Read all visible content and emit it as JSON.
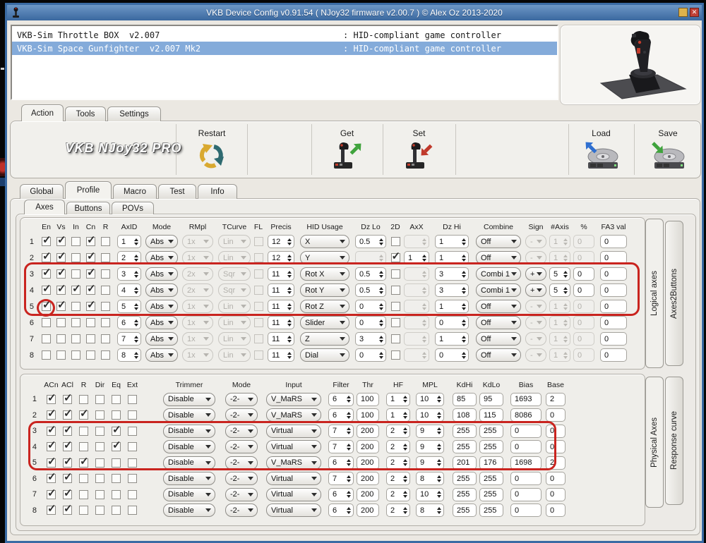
{
  "window": {
    "title": "VKB Device Config v0.91.54 ( NJoy32 firmware v2.00.7 ) © Alex Oz 2013-2020"
  },
  "colors": {
    "titlebar": "#3a689f",
    "selection": "#84abda",
    "annotation": "#c9241f"
  },
  "devices": [
    {
      "name": "VKB-Sim Throttle BOX  v2.007",
      "type": ": HID-compliant game controller"
    },
    {
      "name": "VKB-Sim Space Gunfighter  v2.007 Mk2",
      "type": ": HID-compliant game controller"
    }
  ],
  "main_tabs": [
    "Action",
    "Tools",
    "Settings"
  ],
  "toolbar": {
    "logo": "VKB NJoy32 PRO",
    "restart_label": "Restart",
    "get_label": "Get",
    "set_label": "Set",
    "load_label": "Load",
    "save_label": "Save"
  },
  "profile_tabs": [
    "Global",
    "Profile",
    "Macro",
    "Test",
    "Info"
  ],
  "axes_tabs": [
    "Axes",
    "Buttons",
    "POVs"
  ],
  "side_tabs": {
    "upper": [
      "Logical axes",
      "Axes2Buttons"
    ],
    "lower": [
      "Physical Axes",
      "Response curve"
    ]
  },
  "logical_table": {
    "headers": [
      "En",
      "Vs",
      "In",
      "Cn",
      "R",
      "AxID",
      "Mode",
      "RMpl",
      "TCurve",
      "FL",
      "Precis",
      "HID Usage",
      "Dz Lo",
      "2D",
      "AxX",
      "Dz Hi",
      "Combine",
      "Sign",
      "#Axis",
      "%",
      "FA3 val"
    ],
    "rows": [
      {
        "n": "1",
        "en": true,
        "vs": true,
        "in": false,
        "cn": true,
        "r": false,
        "axid": "1",
        "mode": "Abs",
        "rmpl": "1x",
        "tcurve": "Lin",
        "fl": false,
        "precis": "12",
        "hid": "X",
        "dzlo": "0.5",
        "d2": false,
        "axx": "",
        "dzhi": "1",
        "combine": "Off",
        "sign": "-",
        "naxis": "1",
        "pct": "0",
        "fa3": "0"
      },
      {
        "n": "2",
        "en": true,
        "vs": true,
        "in": false,
        "cn": true,
        "r": false,
        "axid": "2",
        "mode": "Abs",
        "rmpl": "1x",
        "tcurve": "Lin",
        "fl": false,
        "precis": "12",
        "hid": "Y",
        "dzlo": "",
        "d2": true,
        "axx": "1",
        "dzhi": "1",
        "combine": "Off",
        "sign": "-",
        "naxis": "1",
        "pct": "0",
        "fa3": "0"
      },
      {
        "n": "3",
        "en": true,
        "vs": true,
        "in": false,
        "cn": true,
        "r": false,
        "axid": "3",
        "mode": "Abs",
        "rmpl": "2x",
        "tcurve": "Sqr",
        "fl": false,
        "precis": "11",
        "hid": "Rot X",
        "dzlo": "0.5",
        "d2": false,
        "axx": "",
        "dzhi": "3",
        "combine": "Combi 1",
        "sign": "+",
        "naxis": "5",
        "pct": "0",
        "fa3": "0"
      },
      {
        "n": "4",
        "en": true,
        "vs": true,
        "in": true,
        "cn": true,
        "r": false,
        "axid": "4",
        "mode": "Abs",
        "rmpl": "2x",
        "tcurve": "Sqr",
        "fl": false,
        "precis": "11",
        "hid": "Rot Y",
        "dzlo": "0.5",
        "d2": false,
        "axx": "",
        "dzhi": "3",
        "combine": "Combi 1",
        "sign": "+",
        "naxis": "5",
        "pct": "0",
        "fa3": "0"
      },
      {
        "n": "5",
        "en": true,
        "vs": true,
        "in": false,
        "cn": true,
        "r": false,
        "axid": "5",
        "mode": "Abs",
        "rmpl": "1x",
        "tcurve": "Lin",
        "fl": false,
        "precis": "11",
        "hid": "Rot Z",
        "dzlo": "0",
        "d2": false,
        "axx": "",
        "dzhi": "1",
        "combine": "Off",
        "sign": "-",
        "naxis": "1",
        "pct": "0",
        "fa3": "0"
      },
      {
        "n": "6",
        "en": false,
        "vs": false,
        "in": false,
        "cn": false,
        "r": false,
        "axid": "6",
        "mode": "Abs",
        "rmpl": "1x",
        "tcurve": "Lin",
        "fl": false,
        "precis": "11",
        "hid": "Slider",
        "dzlo": "0",
        "d2": false,
        "axx": "",
        "dzhi": "0",
        "combine": "Off",
        "sign": "-",
        "naxis": "1",
        "pct": "0",
        "fa3": "0"
      },
      {
        "n": "7",
        "en": false,
        "vs": false,
        "in": false,
        "cn": false,
        "r": false,
        "axid": "7",
        "mode": "Abs",
        "rmpl": "1x",
        "tcurve": "Lin",
        "fl": false,
        "precis": "11",
        "hid": "Z",
        "dzlo": "3",
        "d2": false,
        "axx": "",
        "dzhi": "1",
        "combine": "Off",
        "sign": "-",
        "naxis": "1",
        "pct": "0",
        "fa3": "0"
      },
      {
        "n": "8",
        "en": false,
        "vs": false,
        "in": false,
        "cn": false,
        "r": false,
        "axid": "8",
        "mode": "Abs",
        "rmpl": "1x",
        "tcurve": "Lin",
        "fl": false,
        "precis": "11",
        "hid": "Dial",
        "dzlo": "0",
        "d2": false,
        "axx": "",
        "dzhi": "0",
        "combine": "Off",
        "sign": "-",
        "naxis": "1",
        "pct": "0",
        "fa3": "0"
      }
    ]
  },
  "physical_table": {
    "headers": [
      "ACn",
      "ACl",
      "R",
      "Dir",
      "Eq",
      "Ext",
      "Trimmer",
      "Mode",
      "Input",
      "Filter",
      "Thr",
      "HF",
      "MPL",
      "KdHi",
      "KdLo",
      "Bias",
      "Base"
    ],
    "rows": [
      {
        "n": "1",
        "acn": true,
        "acl": true,
        "r": false,
        "dir": false,
        "eq": false,
        "ext": false,
        "trim": "Disable",
        "mode": "-2-",
        "input": "V_MaRS",
        "filter": "6",
        "thr": "100",
        "hf": "1",
        "mpl": "10",
        "kdhi": "85",
        "kdlo": "95",
        "bias": "1693",
        "base": "2"
      },
      {
        "n": "2",
        "acn": true,
        "acl": true,
        "r": true,
        "dir": false,
        "eq": false,
        "ext": false,
        "trim": "Disable",
        "mode": "-2-",
        "input": "V_MaRS",
        "filter": "6",
        "thr": "100",
        "hf": "1",
        "mpl": "10",
        "kdhi": "108",
        "kdlo": "115",
        "bias": "8086",
        "base": "0"
      },
      {
        "n": "3",
        "acn": true,
        "acl": true,
        "r": false,
        "dir": false,
        "eq": true,
        "ext": false,
        "trim": "Disable",
        "mode": "-2-",
        "input": "Virtual",
        "filter": "7",
        "thr": "200",
        "hf": "2",
        "mpl": "9",
        "kdhi": "255",
        "kdlo": "255",
        "bias": "0",
        "base": "0"
      },
      {
        "n": "4",
        "acn": true,
        "acl": true,
        "r": false,
        "dir": false,
        "eq": true,
        "ext": false,
        "trim": "Disable",
        "mode": "-2-",
        "input": "Virtual",
        "filter": "7",
        "thr": "200",
        "hf": "2",
        "mpl": "9",
        "kdhi": "255",
        "kdlo": "255",
        "bias": "0",
        "base": "0"
      },
      {
        "n": "5",
        "acn": true,
        "acl": true,
        "r": true,
        "dir": false,
        "eq": false,
        "ext": false,
        "trim": "Disable",
        "mode": "-2-",
        "input": "V_MaRS",
        "filter": "6",
        "thr": "200",
        "hf": "2",
        "mpl": "9",
        "kdhi": "201",
        "kdlo": "176",
        "bias": "1698",
        "base": "2"
      },
      {
        "n": "6",
        "acn": true,
        "acl": true,
        "r": false,
        "dir": false,
        "eq": false,
        "ext": false,
        "trim": "Disable",
        "mode": "-2-",
        "input": "Virtual",
        "filter": "7",
        "thr": "200",
        "hf": "2",
        "mpl": "8",
        "kdhi": "255",
        "kdlo": "255",
        "bias": "0",
        "base": "0"
      },
      {
        "n": "7",
        "acn": true,
        "acl": true,
        "r": false,
        "dir": false,
        "eq": false,
        "ext": false,
        "trim": "Disable",
        "mode": "-2-",
        "input": "Virtual",
        "filter": "6",
        "thr": "200",
        "hf": "2",
        "mpl": "10",
        "kdhi": "255",
        "kdlo": "255",
        "bias": "0",
        "base": "0"
      },
      {
        "n": "8",
        "acn": true,
        "acl": true,
        "r": false,
        "dir": false,
        "eq": false,
        "ext": false,
        "trim": "Disable",
        "mode": "-2-",
        "input": "Virtual",
        "filter": "6",
        "thr": "200",
        "hf": "2",
        "mpl": "8",
        "kdhi": "255",
        "kdlo": "255",
        "bias": "0",
        "base": "0"
      }
    ]
  }
}
